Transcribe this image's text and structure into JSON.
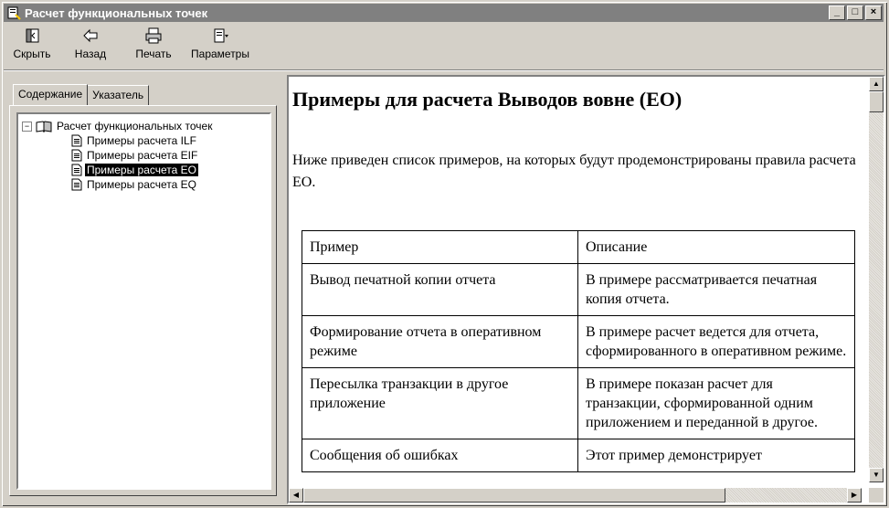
{
  "window": {
    "title": "Расчет функциональных точек"
  },
  "titlebar_buttons": {
    "minimize": "_",
    "maximize": "□",
    "close": "×"
  },
  "toolbar": {
    "hide": "Скрыть",
    "back": "Назад",
    "print": "Печать",
    "options": "Параметры"
  },
  "tabs": {
    "contents": "Содержание",
    "index": "Указатель"
  },
  "tree": {
    "root": "Расчет функциональных точек",
    "items": [
      {
        "label": "Примеры расчета ILF",
        "selected": false
      },
      {
        "label": "Примеры расчета EIF",
        "selected": false
      },
      {
        "label": "Примеры расчета EO",
        "selected": true
      },
      {
        "label": "Примеры расчета EQ",
        "selected": false
      }
    ]
  },
  "document": {
    "heading": "Примеры для расчета Выводов вовне (EO)",
    "intro": "Ниже приведен список примеров, на которых будут продемонстрированы правила расчета ЕО.",
    "table": {
      "headers": [
        "Пример",
        "Описание"
      ],
      "rows": [
        [
          "Вывод печатной копии отчета",
          "В примере рассматривается печатная копия отчета."
        ],
        [
          "Формирование отчета в оперативном режиме",
          "В примере расчет ведется для отчета, сформированного в оперативном режиме."
        ],
        [
          "Пересылка транзакции в другое приложение",
          "В примере показан расчет для транзакции, сформированной одним приложением и переданной в другое."
        ],
        [
          "Сообщения об ошибках",
          "Этот пример демонстрирует"
        ]
      ]
    }
  },
  "scroll": {
    "up": "▲",
    "down": "▼",
    "left": "◀",
    "right": "▶"
  }
}
